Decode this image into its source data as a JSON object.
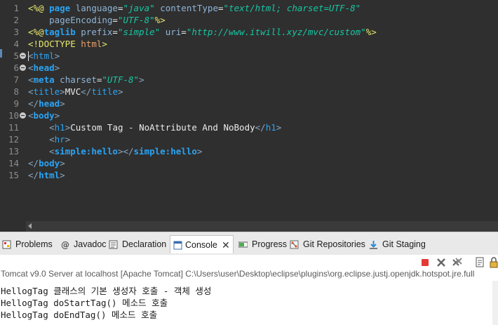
{
  "editor": {
    "line_numbers": [
      "1",
      "2",
      "3",
      "4",
      "5",
      "6",
      "7",
      "8",
      "9",
      "10",
      "11",
      "12",
      "13",
      "14",
      "15"
    ],
    "lines": [
      [
        {
          "c": "dt",
          "t": "<%@ "
        },
        {
          "c": "k",
          "t": "page "
        },
        {
          "c": "a",
          "t": "language"
        },
        {
          "c": "txt",
          "t": "="
        },
        {
          "c": "v",
          "t": "\"java\""
        },
        {
          "c": "txt",
          "t": " "
        },
        {
          "c": "a",
          "t": "contentType"
        },
        {
          "c": "txt",
          "t": "="
        },
        {
          "c": "v",
          "t": "\"text/html; charset=UTF-8\""
        }
      ],
      [
        {
          "c": "txt",
          "t": "    "
        },
        {
          "c": "a",
          "t": "pageEncoding"
        },
        {
          "c": "txt",
          "t": "="
        },
        {
          "c": "v",
          "t": "\"UTF-8\""
        },
        {
          "c": "dt",
          "t": "%>"
        }
      ],
      [
        {
          "c": "dt",
          "t": "<%@"
        },
        {
          "c": "k",
          "t": "taglib "
        },
        {
          "c": "a",
          "t": "prefix"
        },
        {
          "c": "txt",
          "t": "="
        },
        {
          "c": "v",
          "t": "\"simple\""
        },
        {
          "c": "txt",
          "t": " "
        },
        {
          "c": "a",
          "t": "uri"
        },
        {
          "c": "txt",
          "t": "="
        },
        {
          "c": "v",
          "t": "\"http://www.itwill.xyz/mvc/custom\""
        },
        {
          "c": "dt",
          "t": "%>"
        }
      ],
      [
        {
          "c": "dt",
          "t": "<!DOCTYPE "
        },
        {
          "c": "p",
          "t": "html"
        },
        {
          "c": "dt",
          "t": ">"
        }
      ],
      [
        {
          "c": "br",
          "t": "<"
        },
        {
          "c": "t",
          "t": "html"
        },
        {
          "c": "br",
          "t": ">"
        }
      ],
      [
        {
          "c": "br",
          "t": "<"
        },
        {
          "c": "k",
          "t": "head"
        },
        {
          "c": "br",
          "t": ">"
        }
      ],
      [
        {
          "c": "br",
          "t": "<"
        },
        {
          "c": "k",
          "t": "meta "
        },
        {
          "c": "a",
          "t": "charset"
        },
        {
          "c": "txt",
          "t": "="
        },
        {
          "c": "v",
          "t": "\"UTF-8\""
        },
        {
          "c": "br",
          "t": ">"
        }
      ],
      [
        {
          "c": "br",
          "t": "<"
        },
        {
          "c": "t",
          "t": "title"
        },
        {
          "c": "br",
          "t": ">"
        },
        {
          "c": "txt",
          "t": "MVC"
        },
        {
          "c": "br",
          "t": "</"
        },
        {
          "c": "t",
          "t": "title"
        },
        {
          "c": "br",
          "t": ">"
        }
      ],
      [
        {
          "c": "br",
          "t": "</"
        },
        {
          "c": "k",
          "t": "head"
        },
        {
          "c": "br",
          "t": ">"
        }
      ],
      [
        {
          "c": "br",
          "t": "<"
        },
        {
          "c": "k",
          "t": "body"
        },
        {
          "c": "br",
          "t": ">"
        }
      ],
      [
        {
          "c": "txt",
          "t": "    "
        },
        {
          "c": "br",
          "t": "<"
        },
        {
          "c": "t",
          "t": "h1"
        },
        {
          "c": "br",
          "t": ">"
        },
        {
          "c": "txt",
          "t": "Custom Tag - NoAttribute And NoBody"
        },
        {
          "c": "br",
          "t": "</"
        },
        {
          "c": "t",
          "t": "h1"
        },
        {
          "c": "br",
          "t": ">"
        }
      ],
      [
        {
          "c": "txt",
          "t": "    "
        },
        {
          "c": "br",
          "t": "<"
        },
        {
          "c": "t",
          "t": "hr"
        },
        {
          "c": "br",
          "t": ">"
        }
      ],
      [
        {
          "c": "txt",
          "t": "    "
        },
        {
          "c": "br",
          "t": "<"
        },
        {
          "c": "kk",
          "t": "simple:hello"
        },
        {
          "c": "br",
          "t": "></"
        },
        {
          "c": "kk",
          "t": "simple:hello"
        },
        {
          "c": "br",
          "t": ">"
        }
      ],
      [
        {
          "c": "br",
          "t": "</"
        },
        {
          "c": "k",
          "t": "body"
        },
        {
          "c": "br",
          "t": ">"
        }
      ],
      [
        {
          "c": "br",
          "t": "</"
        },
        {
          "c": "k",
          "t": "html"
        },
        {
          "c": "br",
          "t": ">"
        }
      ]
    ],
    "fold_lines": [
      5,
      6,
      10
    ],
    "current_line": 5
  },
  "tabs": [
    {
      "label": "Problems",
      "icon": "problems-icon"
    },
    {
      "label": "Javadoc",
      "icon": "javadoc-icon"
    },
    {
      "label": "Declaration",
      "icon": "declaration-icon"
    },
    {
      "label": "Console",
      "icon": "console-icon",
      "active": true
    },
    {
      "label": "Progress",
      "icon": "progress-icon"
    },
    {
      "label": "Git Repositories",
      "icon": "git-repositories-icon"
    },
    {
      "label": "Git Staging",
      "icon": "git-staging-icon"
    }
  ],
  "console": {
    "description": "Tomcat v9.0 Server at localhost [Apache Tomcat] C:\\Users\\user\\Desktop\\eclipse\\plugins\\org.eclipse.justj.openjdk.hotspot.jre.full",
    "output": [
      "HellogTag 클래스의 기본 생성자 호출 - 객체 생성",
      "HellogTag doStartTag() 메소드 호출",
      "HellogTag doEndTag() 메소드 호출"
    ]
  },
  "colors": {
    "editor_bg": "#2f2f2f",
    "keyword": "#2aa4f5",
    "string": "#17c6a3",
    "directive": "#e6e86c",
    "terminate": "#e53935"
  }
}
